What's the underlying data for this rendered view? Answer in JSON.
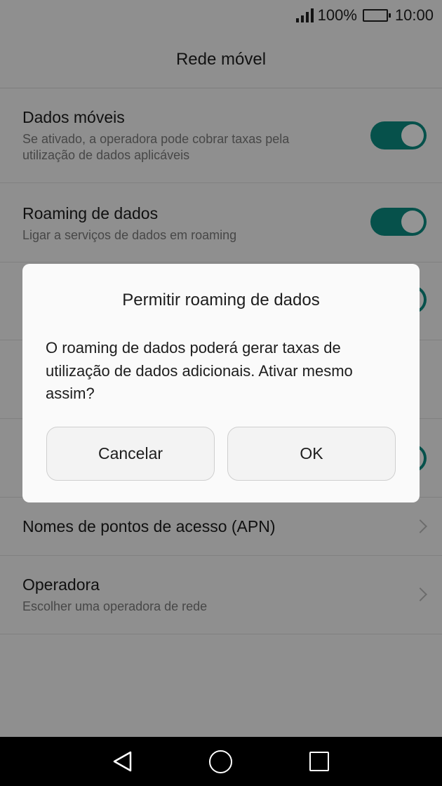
{
  "status_bar": {
    "battery_percent": "100%",
    "time": "10:00"
  },
  "header": {
    "title": "Rede móvel"
  },
  "settings": [
    {
      "title": "Dados móveis",
      "subtitle": "Se ativado, a operadora pode cobrar taxas pela utilização de dados aplicáveis",
      "control": "toggle",
      "enabled": true
    },
    {
      "title": "Roaming de dados",
      "subtitle": "Ligar a serviços de dados em roaming",
      "control": "toggle",
      "enabled": true
    },
    {
      "title": "Nomes de pontos de acesso (APN)",
      "subtitle": "",
      "control": "chevron"
    },
    {
      "title": "Operadora",
      "subtitle": "Escolher uma operadora de rede",
      "control": "chevron"
    }
  ],
  "dialog": {
    "title": "Permitir roaming de dados",
    "message": "O roaming de dados poderá gerar taxas de utilização de dados adicionais. Ativar mesmo assim?",
    "cancel_label": "Cancelar",
    "ok_label": "OK"
  },
  "colors": {
    "accent": "#0b8c82",
    "background": "#f6f6f6",
    "navbar": "#000000"
  },
  "icons": {
    "signal": "signal-icon",
    "battery": "battery-icon",
    "back": "back-icon",
    "home": "home-icon",
    "recent": "recent-apps-icon"
  }
}
